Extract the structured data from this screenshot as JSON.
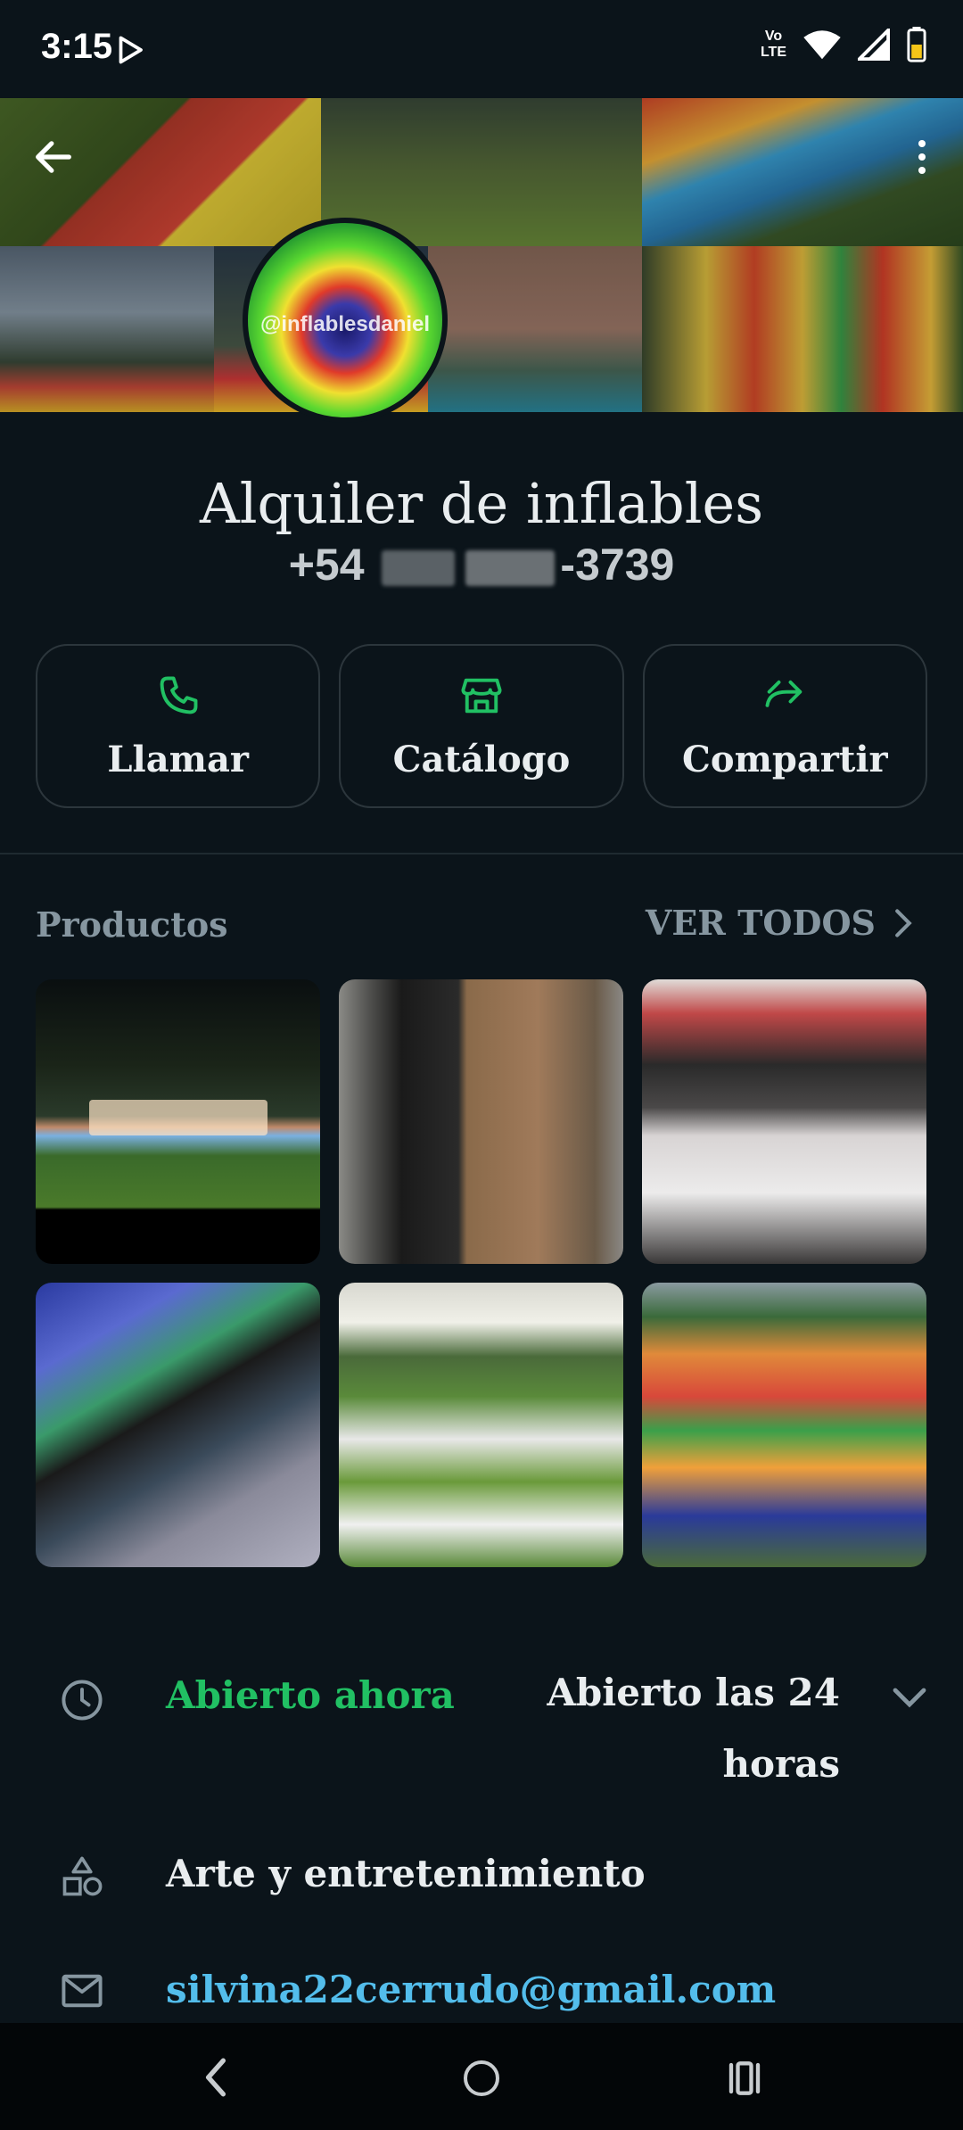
{
  "status_bar": {
    "time": "3:15",
    "volte_top": "Vo",
    "volte_bottom": "LTE",
    "icons": [
      "play-store-icon",
      "wifi-icon",
      "signal-icon",
      "battery-icon"
    ]
  },
  "header": {
    "avatar_watermark": "@inflablesdaniel",
    "icons": [
      "back-arrow-icon",
      "more-vert-icon"
    ]
  },
  "profile": {
    "name": "Alquiler de inflables",
    "phone_prefix": "+54",
    "phone_suffix": "-3739"
  },
  "actions": [
    {
      "label": "Llamar",
      "icon": "phone-icon"
    },
    {
      "label": "Catálogo",
      "icon": "storefront-icon"
    },
    {
      "label": "Compartir",
      "icon": "share-forward-icon"
    }
  ],
  "products": {
    "title": "Productos",
    "see_all": "VER TODOS"
  },
  "hours": {
    "status": "Abierto ahora",
    "value": "Abierto las 24 horas"
  },
  "category": "Arte y entretenimiento",
  "email": "silvina22cerrudo@gmail.com",
  "colors": {
    "background": "#0b141a",
    "accent_green": "#21c063",
    "link_blue": "#53bdeb",
    "muted": "#8696a0"
  }
}
